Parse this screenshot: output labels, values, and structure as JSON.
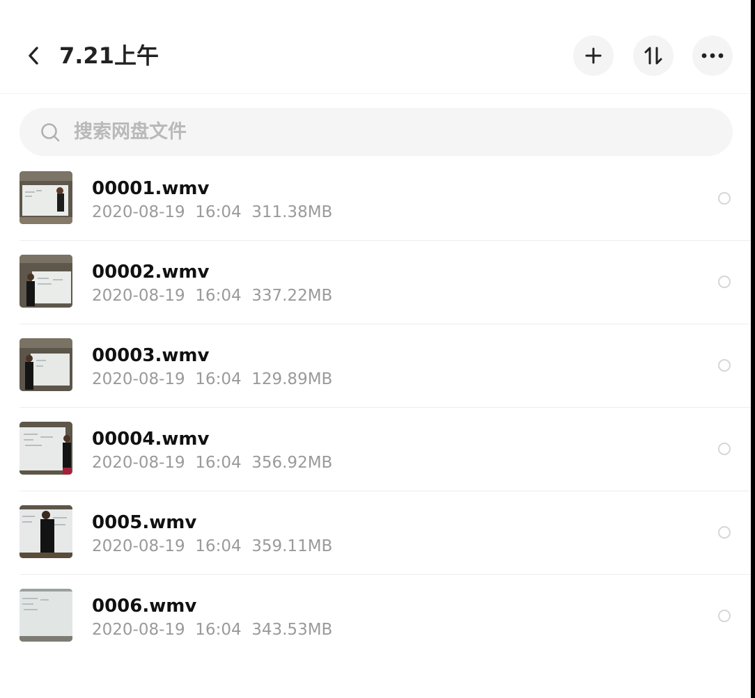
{
  "header": {
    "title": "7.21上午",
    "back_icon": "chevron-left-icon",
    "actions": [
      {
        "name": "add",
        "icon": "plus-icon"
      },
      {
        "name": "sort",
        "icon": "sort-arrows-icon"
      },
      {
        "name": "more",
        "icon": "more-dots-icon"
      }
    ]
  },
  "search": {
    "placeholder": "搜索网盘文件",
    "icon": "search-icon"
  },
  "files": [
    {
      "name": "00001.wmv",
      "date": "2020-08-19",
      "time": "16:04",
      "size": "311.38MB"
    },
    {
      "name": "00002.wmv",
      "date": "2020-08-19",
      "time": "16:04",
      "size": "337.22MB"
    },
    {
      "name": "00003.wmv",
      "date": "2020-08-19",
      "time": "16:04",
      "size": "129.89MB"
    },
    {
      "name": "00004.wmv",
      "date": "2020-08-19",
      "time": "16:04",
      "size": "356.92MB"
    },
    {
      "name": "0005.wmv",
      "date": "2020-08-19",
      "time": "16:04",
      "size": "359.11MB"
    },
    {
      "name": "0006.wmv",
      "date": "2020-08-19",
      "time": "16:04",
      "size": "343.53MB"
    }
  ],
  "colors": {
    "title": "#222222",
    "filename": "#111111",
    "meta": "#9a9a9a",
    "placeholder": "#b9b9b9",
    "button_bg": "#f4f4f4",
    "search_bg": "#f5f5f5"
  }
}
